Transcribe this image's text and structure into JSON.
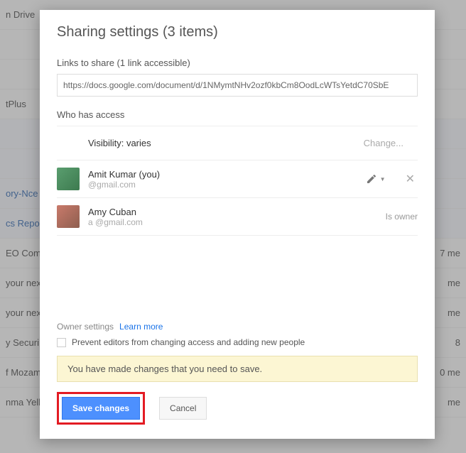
{
  "background": {
    "rows": [
      {
        "left": "n Drive",
        "right": ""
      },
      {
        "left": "",
        "right": ""
      },
      {
        "left": "",
        "right": ""
      },
      {
        "left": "tPlus",
        "right": ""
      },
      {
        "left": "",
        "right": ""
      },
      {
        "left": "",
        "right": ""
      },
      {
        "left": "ory-Nce",
        "right": ""
      },
      {
        "left": "cs Repor",
        "right": ""
      },
      {
        "left": "EO Comp",
        "right": "7 me"
      },
      {
        "left": "your nex",
        "right": "me"
      },
      {
        "left": "your nex",
        "right": "me"
      },
      {
        "left": "y Securi",
        "right": "8"
      },
      {
        "left": "f Mozam",
        "right": "0 me"
      },
      {
        "left": "nma Yell",
        "right": "me"
      }
    ]
  },
  "modal": {
    "title": "Sharing settings (3 items)",
    "linksLabel": "Links to share (1 link accessible)",
    "linkValue": "https://docs.google.com/document/d/1NMymtNHv2ozf0kbCm8OodLcWTsYetdC70SbE",
    "accessLabel": "Who has access",
    "visibility": "Visibility: varies",
    "changeLabel": "Change...",
    "people": [
      {
        "name": "Amit Kumar (you)",
        "email": "@gmail.com",
        "role": "editor"
      },
      {
        "name": "Amy Cuban",
        "email": "a            @gmail.com",
        "roleLabel": "Is owner"
      }
    ],
    "ownerSettingsLabel": "Owner settings",
    "learnMore": "Learn more",
    "checkboxLabel": "Prevent editors from changing access and adding new people",
    "warning": "You have made changes that you need to save.",
    "saveLabel": "Save changes",
    "cancelLabel": "Cancel"
  }
}
